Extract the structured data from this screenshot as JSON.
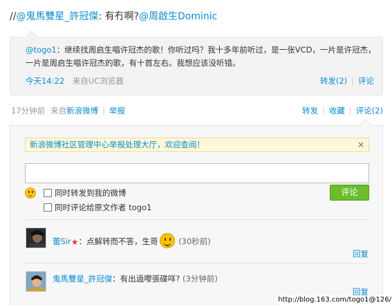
{
  "post": {
    "prefix": "//",
    "mention1": "@鬼馬雙星_許冠傑",
    "text": ": 有冇啊?",
    "mention2": "@周啟生Dominic"
  },
  "quote": {
    "author": "@togo1",
    "text": "：继续找周启生唱许冠杰的歌！你听过吗？我十多年前听过，是一张VCD，一片是许冠杰，一片是周启生唱许冠杰的歌，有十首左右。我想应该没听错。",
    "time": "今天14:22",
    "source_prefix": "来自",
    "source": "UC浏览器",
    "repost": "转发(2)",
    "comment": "评论"
  },
  "meta": {
    "time": "17分钟前",
    "source_prefix": "来自",
    "source": "新浪微博",
    "report": "举报",
    "repost": "转发",
    "favorite": "收藏",
    "comment": "评论(2)"
  },
  "notice": {
    "text": "新浪微博社区管理中心举报处理大厅，欢迎查阅！",
    "close": "×"
  },
  "composer": {
    "placeholder": "",
    "option_repost": "同时转发到我的微博",
    "option_comment_author": "同时评论给原文作者 togo1",
    "submit": "评论",
    "emoticon": "smiley-icon"
  },
  "comments": [
    {
      "user": "蕾Sir",
      "text": "：点解转而不答，生哥",
      "time": "(30秒前)",
      "reply": "回复"
    },
    {
      "user": "鬼馬雙星_許冠傑",
      "text": "：有出過嚟張碟咩? ",
      "time": "(3分钟前)",
      "reply": "回复"
    }
  ],
  "watermark": "http://blog.163.com/togo1@126/",
  "colors": {
    "link": "#0a8cd2",
    "button": "#6bbd2a",
    "notice_bg": "#fef8d8"
  }
}
